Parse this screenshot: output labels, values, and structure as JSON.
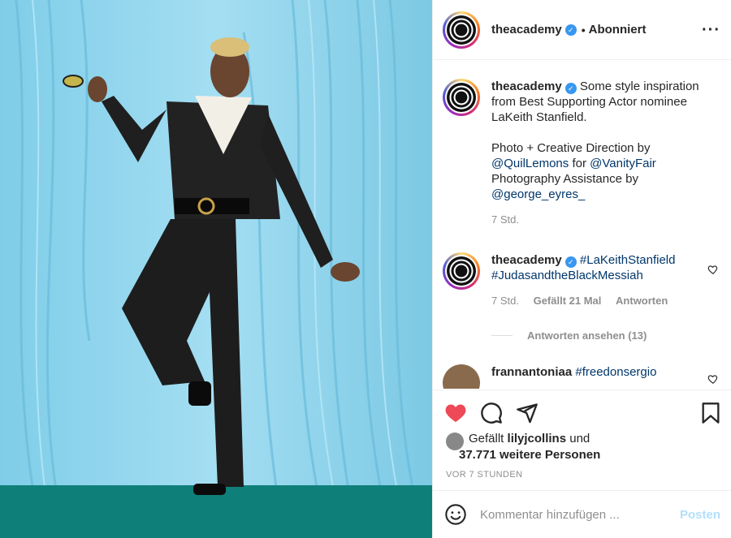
{
  "post": {
    "author": "theacademy",
    "verified": true,
    "follow_status": "Abonniert",
    "more_icon": "more-horizontal-icon"
  },
  "caption": {
    "user": "theacademy",
    "text": "Some style inspiration from Best Supporting Actor nominee LaKeith Stanfield.",
    "credit_line1": "Photo + Creative Direction by",
    "mention1": "@QuilLemons",
    "for_text": "for",
    "mention2": "@VanityFair",
    "credit_line2": "Photography Assistance by",
    "mention3": "@george_eyres_",
    "time": "7 Std."
  },
  "comments": [
    {
      "user": "theacademy",
      "hashtag1": "#LaKeithStanfield",
      "hashtag2": "#JudasandtheBlackMessiah",
      "time": "7 Std.",
      "likes": "Gefällt 21 Mal",
      "reply": "Antworten"
    },
    {
      "user": "frannantoniaa",
      "hashtag1": "#freedonsergio"
    }
  ],
  "view_replies": "Antworten ansehen (13)",
  "likes": {
    "prefix": "Gefällt",
    "user": "lilyjcollins",
    "und": "und",
    "count": "37.771 weitere Personen"
  },
  "timestamp": "VOR 7 STUNDEN",
  "composer": {
    "placeholder": "Kommentar hinzufügen ...",
    "post_label": "Posten"
  },
  "colors": {
    "heart": "#ed4956",
    "link": "#00376b",
    "muted": "#8e8e8e",
    "post_disabled": "#b2dffc"
  }
}
